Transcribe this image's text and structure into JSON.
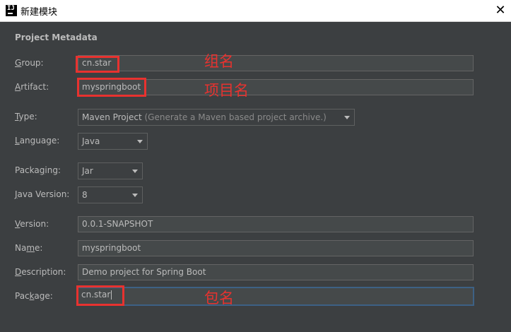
{
  "window": {
    "title": "新建模块",
    "icon": "intellij-idea-icon",
    "close_symbol": "✕"
  },
  "section_title": "Project Metadata",
  "form": {
    "group": {
      "mnemonic": "G",
      "rest": "roup:",
      "value": "cn.star"
    },
    "artifact": {
      "mnemonic": "A",
      "rest": "rtifact:",
      "value": "myspringboot"
    },
    "type": {
      "mnemonic": "T",
      "rest": "ype:",
      "value": "Maven Project",
      "hint": "(Generate a Maven based project archive.)"
    },
    "language": {
      "mnemonic": "L",
      "rest": "anguage:",
      "value": "Java"
    },
    "packaging": {
      "pre": "Packa",
      "mnemonic": "g",
      "rest": "ing:",
      "value": "Jar"
    },
    "java_version": {
      "mnemonic": "J",
      "rest": "ava Version:",
      "value": "8"
    },
    "version": {
      "mnemonic": "V",
      "rest": "ersion:",
      "value": "0.0.1-SNAPSHOT"
    },
    "name": {
      "pre": "Na",
      "mnemonic": "m",
      "rest": "e:",
      "value": "myspringboot"
    },
    "description": {
      "mnemonic": "D",
      "rest": "escription:",
      "value": "Demo project for Spring Boot"
    },
    "package": {
      "pre": "Pac",
      "mnemonic": "k",
      "rest": "age:",
      "value": "cn.star"
    }
  },
  "annotations": {
    "group": "组名",
    "artifact": "项目名",
    "package": "包名"
  },
  "colors": {
    "background": "#3c3f41",
    "field": "#45494a",
    "annotation": "#e8322f",
    "focus": "#3d6185"
  }
}
